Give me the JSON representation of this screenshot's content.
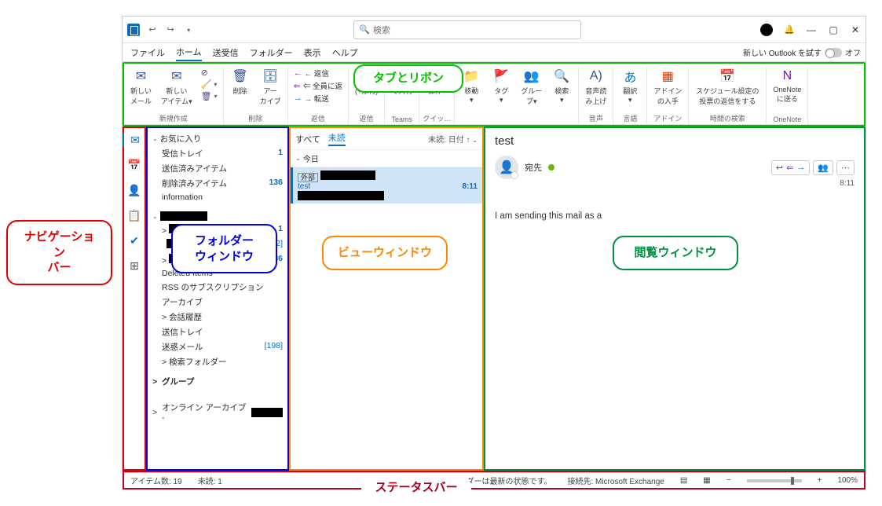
{
  "title_bar": {
    "search_placeholder": "検索",
    "bell_icon": "bell-icon",
    "minimize": "—",
    "maximize": "▢",
    "close": "✕"
  },
  "menu_tabs": {
    "items": [
      "ファイル",
      "ホーム",
      "送受信",
      "フォルダー",
      "表示",
      "ヘルプ"
    ],
    "active_index": 1,
    "try_new_label": "新しい Outlook を試す",
    "toggle_state": "オフ"
  },
  "ribbon": {
    "groups": [
      {
        "label": "新規作成",
        "buttons": [
          {
            "t": "新しい\nメール"
          },
          {
            "t": "新しい\nアイテム▾"
          }
        ],
        "side": [
          {
            "t": "☺"
          },
          {
            "t": "✎▾"
          },
          {
            "t": "✖▾"
          }
        ]
      },
      {
        "label": "削除",
        "buttons": [
          {
            "t": "削除"
          },
          {
            "t": "アー\nカイブ"
          }
        ]
      },
      {
        "label": "返信",
        "stack": [
          "← 返信",
          "⇐ 全員に返",
          "→ 転送"
        ]
      },
      {
        "label": "返信",
        "buttons": [
          {
            "t": "(+添付)"
          }
        ]
      },
      {
        "label": "Teams",
        "buttons": [
          {
            "t": "で共有"
          }
        ]
      },
      {
        "label": "クイッ…",
        "buttons": [
          {
            "t": "操作▾"
          }
        ]
      },
      {
        "label": "",
        "buttons": [
          {
            "t": "移動\n▾"
          },
          {
            "t": "タグ\n▾"
          },
          {
            "t": "グルー\nプ▾"
          },
          {
            "t": "検索\n▾"
          }
        ]
      },
      {
        "label": "音声",
        "buttons": [
          {
            "t": "音声読\nみ上げ"
          }
        ]
      },
      {
        "label": "言語",
        "buttons": [
          {
            "t": "翻訳\n▾"
          }
        ]
      },
      {
        "label": "アドイン",
        "buttons": [
          {
            "t": "アドイン\nの入手"
          }
        ]
      },
      {
        "label": "時間の検索",
        "buttons": [
          {
            "t": "スケジュール設定の\n投票の返信をする"
          }
        ]
      },
      {
        "label": "OneNote",
        "buttons": [
          {
            "t": "OneNote\nに送る"
          }
        ]
      }
    ]
  },
  "navbar": {
    "icons": [
      "mail",
      "calendar",
      "people",
      "tasks",
      "check",
      "more"
    ]
  },
  "folders": {
    "fav_header": "お気に入り",
    "fav": [
      {
        "name": "受信トレイ",
        "count": "1"
      },
      {
        "name": "送信済みアイテム",
        "count": ""
      },
      {
        "name": "削除済みアイテム",
        "count": "136"
      },
      {
        "name": "information",
        "count": ""
      }
    ],
    "acct_redacted": true,
    "acct_items": [
      {
        "name": "",
        "count": "1",
        "redact": true
      },
      {
        "name": "",
        "count": "[2]",
        "redact": true,
        "bracket": true
      },
      {
        "name": "",
        "count": "36",
        "redact": true
      },
      {
        "name": "Deleted Items",
        "count": ""
      },
      {
        "name": "RSS のサブスクリプション",
        "count": ""
      },
      {
        "name": "アーカイブ",
        "count": ""
      },
      {
        "name": "会話履歴",
        "count": "",
        "expand": true
      },
      {
        "name": "送信トレイ",
        "count": ""
      },
      {
        "name": "迷惑メール",
        "count": "[198]",
        "bracket": true
      },
      {
        "name": "検索フォルダー",
        "count": "",
        "expand": true
      }
    ],
    "groups_header": "グループ",
    "archive_header": "オンライン アーカイブ - "
  },
  "view": {
    "tabs": [
      "すべて",
      "未読"
    ],
    "active_tab": 1,
    "sort_label": "未読: 日付 ↑",
    "date_header": "今日",
    "msg": {
      "badge": "外部",
      "subject": "test",
      "time": "8:11"
    }
  },
  "reading": {
    "subject": "test",
    "to_label": "宛先",
    "time": "8:11",
    "body": "I am sending this mail as a"
  },
  "status": {
    "items": "アイテム数: 19",
    "unread": "未読: 1",
    "sync": "このフォルダーは最新の状態です。",
    "server": "接続先: Microsoft Exchange",
    "zoom": "100%"
  },
  "annotations": {
    "nav": "ナビゲーション\nバー",
    "folder": "フォルダー\nウィンドウ",
    "view": "ビューウィンドウ",
    "read": "閲覧ウィンドウ",
    "ribbon": "タブとリボン",
    "status": "ステータスバー"
  }
}
